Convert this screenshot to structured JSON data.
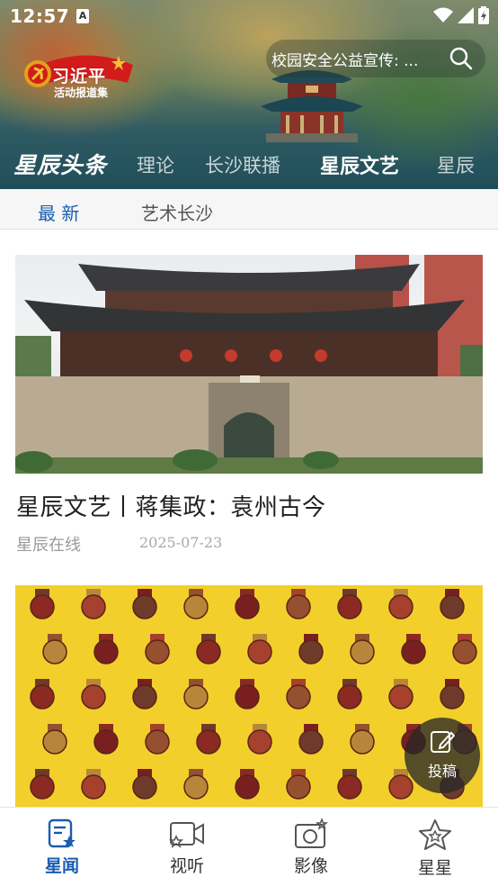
{
  "status_bar": {
    "time": "12:57",
    "notification_glyph": "A"
  },
  "header": {
    "logo_title": "习近平",
    "logo_subtitle": "活动报道集",
    "search_hint": "校园安全公益宣传: ..."
  },
  "channels": {
    "brand": "星辰头条",
    "items": [
      "理论",
      "长沙联播",
      "星辰文艺",
      "星辰"
    ],
    "active": "星辰文艺"
  },
  "sub_tabs": {
    "items": [
      "最 新",
      "艺术长沙"
    ],
    "active": "最 新"
  },
  "articles": [
    {
      "title": "星辰文艺丨蒋集政：袁州古今",
      "source": "星辰在线",
      "date": "2025-07-23"
    }
  ],
  "fab": {
    "label": "投稿"
  },
  "bottom_nav": {
    "items": [
      "星闻",
      "视听",
      "影像",
      "星星"
    ],
    "active": "星闻"
  },
  "colors": {
    "accent": "#1a5cb0",
    "medal_bg": "#f2cf2a"
  }
}
